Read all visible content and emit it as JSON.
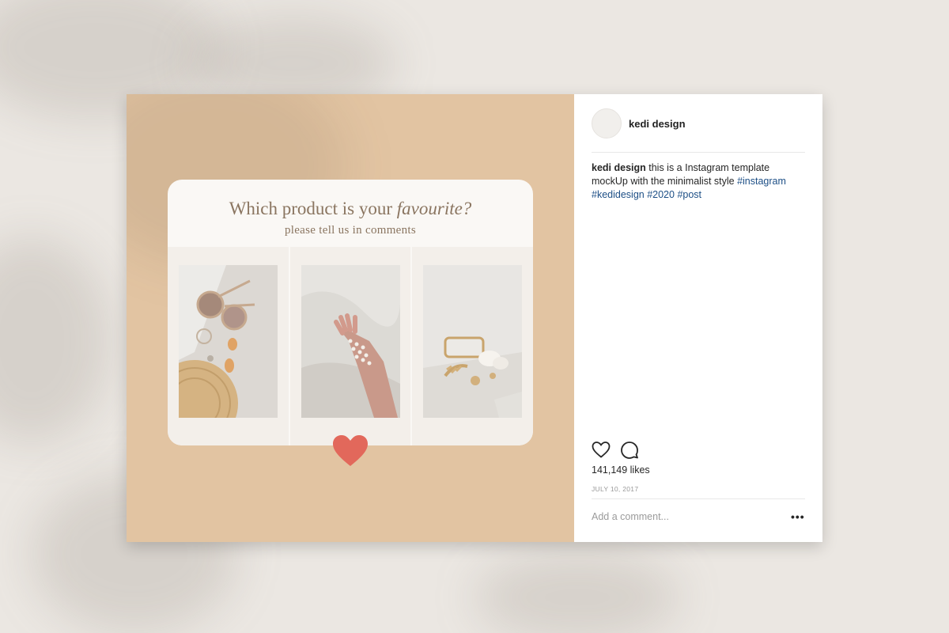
{
  "post": {
    "question_prefix": "Which product is your ",
    "question_accent": "favourite?",
    "question_sub": "please tell us in comments"
  },
  "sidebar": {
    "username": "kedi design",
    "caption": {
      "user": "kedi design",
      "text": " this is a Instagram template mockUp with the minimalist style ",
      "tags": [
        "#instagram",
        "#kedidesign",
        "#2020",
        "#post"
      ]
    },
    "likes": "141,149 likes",
    "date": "JULY 10, 2017",
    "comment_placeholder": "Add a comment...",
    "more_label": "•••"
  },
  "colors": {
    "background": "#ebe7e2",
    "post_background": "#e2c4a2",
    "card_background": "#faf8f5",
    "title_text": "#8a7560",
    "heart": "#e2685b",
    "hashtag": "#1d4f86"
  },
  "icons": {
    "like": "heart-outline-icon",
    "comment": "speech-bubble-icon",
    "badge": "heart-filled-icon"
  }
}
